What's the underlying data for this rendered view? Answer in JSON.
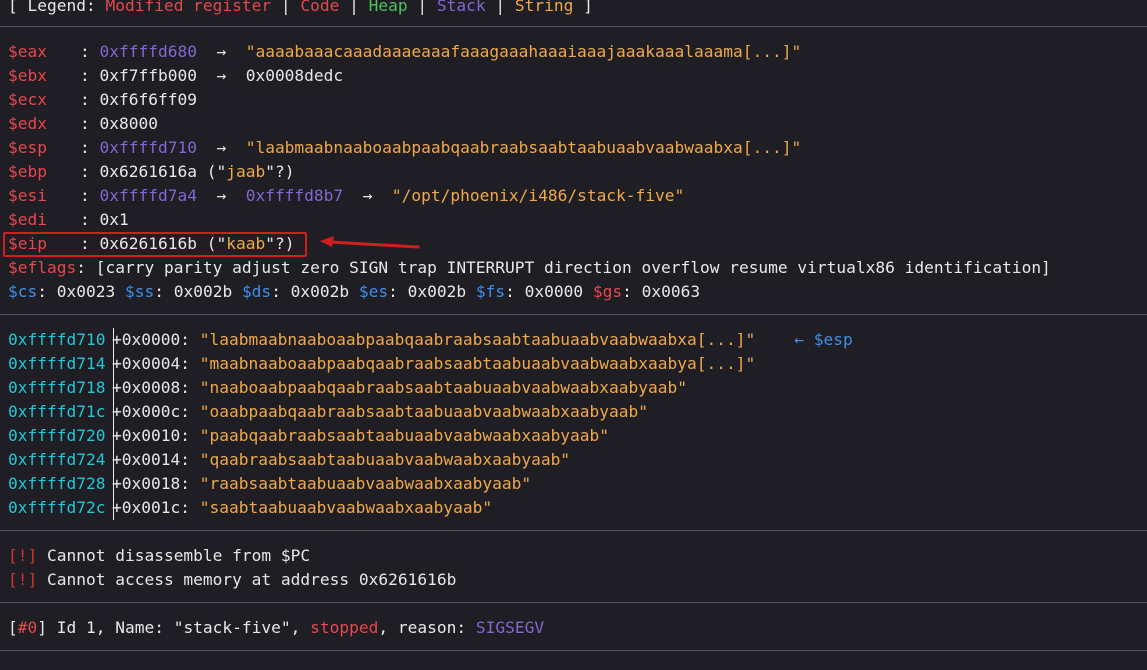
{
  "legend": {
    "open": "[ Legend: ",
    "modified": "Modified register",
    "sep1": " | ",
    "code": "Code",
    "sep2": " | ",
    "heap": "Heap",
    "sep3": " | ",
    "stack": "Stack",
    "sep4": " | ",
    "string": "String",
    "close": " ]"
  },
  "registers": [
    {
      "name": "$eax",
      "colon": ": ",
      "value": "0xffffd680",
      "arrow1": "  →  ",
      "deref": "\"aaaabaaacaaadaaaeaaafaaagaaahaaaiaaajaaakaaalaaama[...]\""
    },
    {
      "name": "$ebx",
      "colon": ": ",
      "value": "0xf7ffb000",
      "arrow1": "  →  ",
      "deref": "0x0008dedc"
    },
    {
      "name": "$ecx",
      "colon": ": ",
      "value": "0xf6f6ff09"
    },
    {
      "name": "$edx",
      "colon": ": ",
      "value": "0x8000"
    },
    {
      "name": "$esp",
      "colon": ": ",
      "value": "0xffffd710",
      "arrow1": "  →  ",
      "deref": "\"laabmaabnaaboaabpaabqaabraabsaabtaabuaabvaabwaabxa[...]\""
    },
    {
      "name": "$ebp",
      "colon": ": ",
      "value": "0x6261616a",
      "paren_open": " (\"",
      "str": "jaab",
      "paren_close": "\"?)"
    },
    {
      "name": "$esi",
      "colon": ": ",
      "value": "0xffffd7a4",
      "arrow1": "  →  ",
      "deref": "0xffffd8b7",
      "arrow2": "  →  ",
      "deref2": "\"/opt/phoenix/i486/stack-five\""
    },
    {
      "name": "$edi",
      "colon": ": ",
      "value": "0x1"
    },
    {
      "name": "$eip",
      "colon": ": ",
      "value": "0x6261616b",
      "paren_open": " (\"",
      "str": "kaab",
      "paren_close": "\"?)"
    }
  ],
  "eflags": {
    "name": "$eflags",
    "value": ": [carry parity adjust zero SIGN trap INTERRUPT direction overflow resume virtualx86 identification]"
  },
  "segments": [
    {
      "name": "$cs",
      "value": ": 0x0023 "
    },
    {
      "name": "$ss",
      "value": ": 0x002b "
    },
    {
      "name": "$ds",
      "value": ": 0x002b "
    },
    {
      "name": "$es",
      "value": ": 0x002b "
    },
    {
      "name": "$fs",
      "value": ": 0x0000 "
    },
    {
      "name": "$gs",
      "value": ": 0x0063"
    }
  ],
  "stack": [
    {
      "addr": "0xffffd710",
      "offset": "+0x0000: ",
      "value": "\"laabmaabnaaboaabpaabqaabraabsaabtaabuaabvaabwaabxa[...]\"",
      "note": "    ← $esp"
    },
    {
      "addr": "0xffffd714",
      "offset": "+0x0004: ",
      "value": "\"maabnaaboaabpaabqaabraabsaabtaabuaabvaabwaabxaabya[...]\""
    },
    {
      "addr": "0xffffd718",
      "offset": "+0x0008: ",
      "value": "\"naaboaabpaabqaabraabsaabtaabuaabvaabwaabxaabyaab\""
    },
    {
      "addr": "0xffffd71c",
      "offset": "+0x000c: ",
      "value": "\"oaabpaabqaabraabsaabtaabuaabvaabwaabxaabyaab\""
    },
    {
      "addr": "0xffffd720",
      "offset": "+0x0010: ",
      "value": "\"paabqaabraabsaabtaabuaabvaabwaabxaabyaab\""
    },
    {
      "addr": "0xffffd724",
      "offset": "+0x0014: ",
      "value": "\"qaabraabsaabtaabuaabvaabwaabxaabyaab\""
    },
    {
      "addr": "0xffffd728",
      "offset": "+0x0018: ",
      "value": "\"raabsaabtaabuaabvaabwaabxaabyaab\""
    },
    {
      "addr": "0xffffd72c",
      "offset": "+0x001c: ",
      "value": "\"saabtaabuaabvaabwaabxaabyaab\""
    }
  ],
  "errors": [
    {
      "tag": "[!]",
      "text": " Cannot disassemble from $PC"
    },
    {
      "tag": "[!]",
      "text": " Cannot access memory at address 0x6261616b"
    }
  ],
  "thread": {
    "open": "[",
    "id_tag": "#0",
    "close": "]",
    "text1": " Id 1, Name: \"stack-five\", ",
    "state": "stopped",
    "text2": ", reason: ",
    "reason": "SIGSEGV"
  },
  "colors": {
    "background": "#1e1e24",
    "modified_register": "#e5484d",
    "code": "#e5484d",
    "heap": "#4fc35b",
    "stack": "#8566d4",
    "string": "#f0a84b",
    "segment": "#3e8fe8",
    "address": "#22c6d8",
    "annotation_box": "#d11f1f"
  }
}
